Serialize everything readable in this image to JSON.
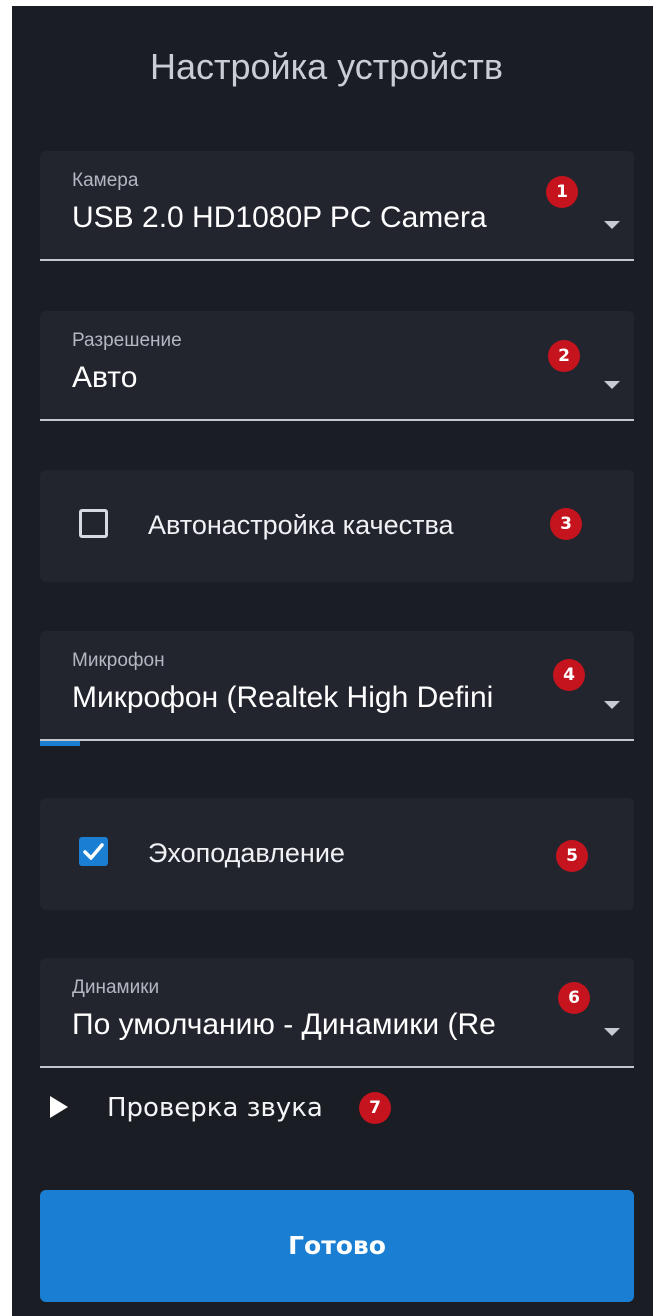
{
  "title": "Настройка устройств",
  "camera": {
    "label": "Камера",
    "value": "USB 2.0 HD1080P PC Camera",
    "badge": "1"
  },
  "resolution": {
    "label": "Разрешение",
    "value": "Авто",
    "badge": "2"
  },
  "auto_quality": {
    "label": "Автонастройка качества",
    "checked": false,
    "badge": "3"
  },
  "microphone": {
    "label": "Микрофон",
    "value": "Микрофон (Realtek High Defini",
    "badge": "4"
  },
  "echo_cancel": {
    "label": "Эхоподавление",
    "checked": true,
    "badge": "5"
  },
  "speakers": {
    "label": "Динамики",
    "value": "По умолчанию - Динамики (Re",
    "badge": "6"
  },
  "sound_test": {
    "label": "Проверка звука",
    "badge": "7"
  },
  "done_button": {
    "label": "Готово"
  },
  "colors": {
    "panel_bg": "#1b1d24",
    "card_bg": "#22252e",
    "accent": "#1a7fd3",
    "badge": "#c5141d"
  },
  "icons": {
    "dropdown": "chevron-down-icon",
    "checkmark": "checkmark-icon",
    "play": "play-icon"
  }
}
